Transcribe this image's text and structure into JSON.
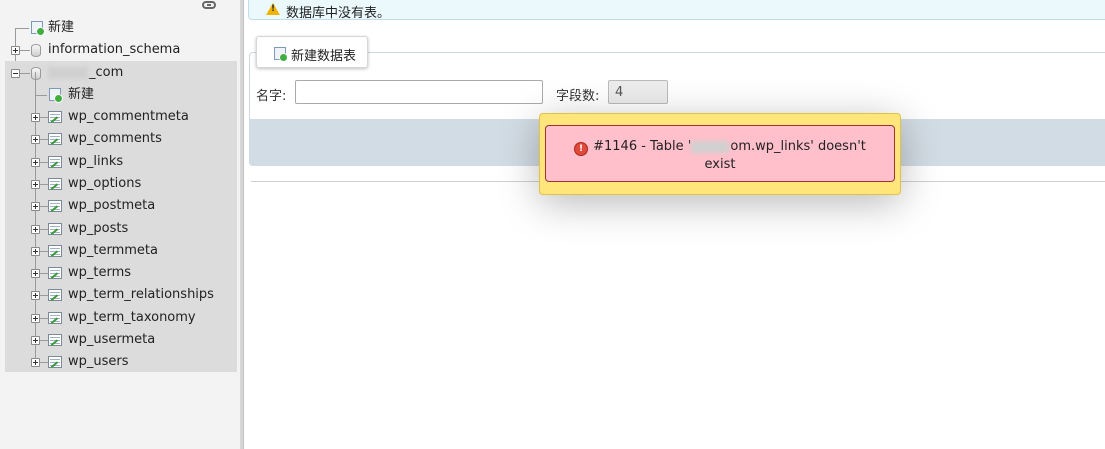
{
  "nav": {
    "new_label": "新建",
    "other_db": "information_schema",
    "current_db": {
      "name_suffix": "_com",
      "new_label": "新建",
      "tables": [
        "wp_commentmeta",
        "wp_comments",
        "wp_links",
        "wp_options",
        "wp_postmeta",
        "wp_posts",
        "wp_termmeta",
        "wp_terms",
        "wp_term_relationships",
        "wp_term_taxonomy",
        "wp_usermeta",
        "wp_users"
      ]
    }
  },
  "main": {
    "notice_text": "数据库中没有表。",
    "create_table_button": "新建数据表",
    "name_label": "名字:",
    "name_value": "",
    "columns_label": "字段数:",
    "columns_value": "4"
  },
  "error": {
    "text_prefix": "#1146 - Table '",
    "text_suffix": "om.wp_links' doesn't exist"
  },
  "colors": {
    "nav_bg": "#f3f3f3",
    "selected_db_bg": "#dcdcdc",
    "notice_bg": "#ebf8fc",
    "error_outer_bg": "#ffe57a",
    "error_inner_bg": "#ffc0cb"
  }
}
